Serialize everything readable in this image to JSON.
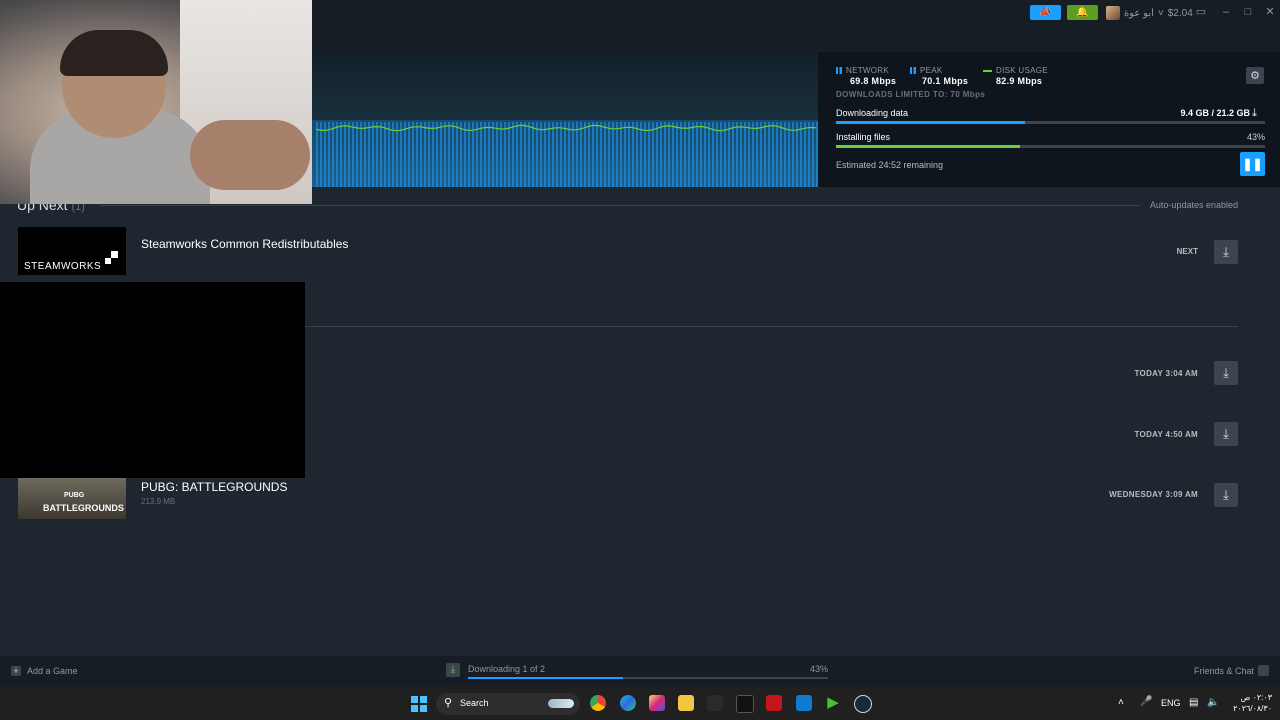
{
  "titlebar": {
    "wallet": "$2.04",
    "account_name": "ابو عوة",
    "announce_icon": "megaphone-icon",
    "notif_icon": "bell-icon"
  },
  "header": {
    "network_label": "NETWORK",
    "network_value": "69.8 Mbps",
    "peak_label": "PEAK",
    "peak_value": "70.1 Mbps",
    "disk_label": "DISK USAGE",
    "disk_value": "82.9 Mbps",
    "limited_text": "DOWNLOADS LIMITED TO: 70 Mbps",
    "downloading_label": "Downloading data",
    "downloading_value": "9.4 GB / 21.2 GB",
    "downloading_fraction": 0.44,
    "installing_label": "Installing files",
    "installing_percent": "43%",
    "installing_fraction": 0.43,
    "estimated": "Estimated 24:52 remaining",
    "colors": {
      "network": "#1a9fff",
      "disk": "#6bcf37",
      "accent": "#1a9fff"
    }
  },
  "up_next": {
    "title": "Up Next",
    "count": "(1)",
    "auto_updates": "Auto-updates enabled",
    "item": {
      "name": "Steamworks Common Redistributables",
      "thumb_text": "STEAMWORKS",
      "action": "NEXT"
    }
  },
  "completed": [
    {
      "when": "TODAY 3:04 AM"
    },
    {
      "when": "TODAY 4:50 AM"
    },
    {
      "name": "PUBG: BATTLEGROUNDS",
      "size": "213.9 MB",
      "thumb_text_top": "PUBG",
      "thumb_text": "BATTLEGROUNDS",
      "when": "WEDNESDAY 3:09 AM"
    }
  ],
  "footer": {
    "add_game": "Add a Game",
    "downloading": "Downloading 1 of 2",
    "percent": "43%",
    "fraction": 0.43,
    "friends": "Friends & Chat"
  },
  "taskbar": {
    "search": "Search",
    "lang": "ENG",
    "time": "٠٢:٠٣ ص",
    "date": "٢٠٢٦/٠٨/٣٠"
  }
}
